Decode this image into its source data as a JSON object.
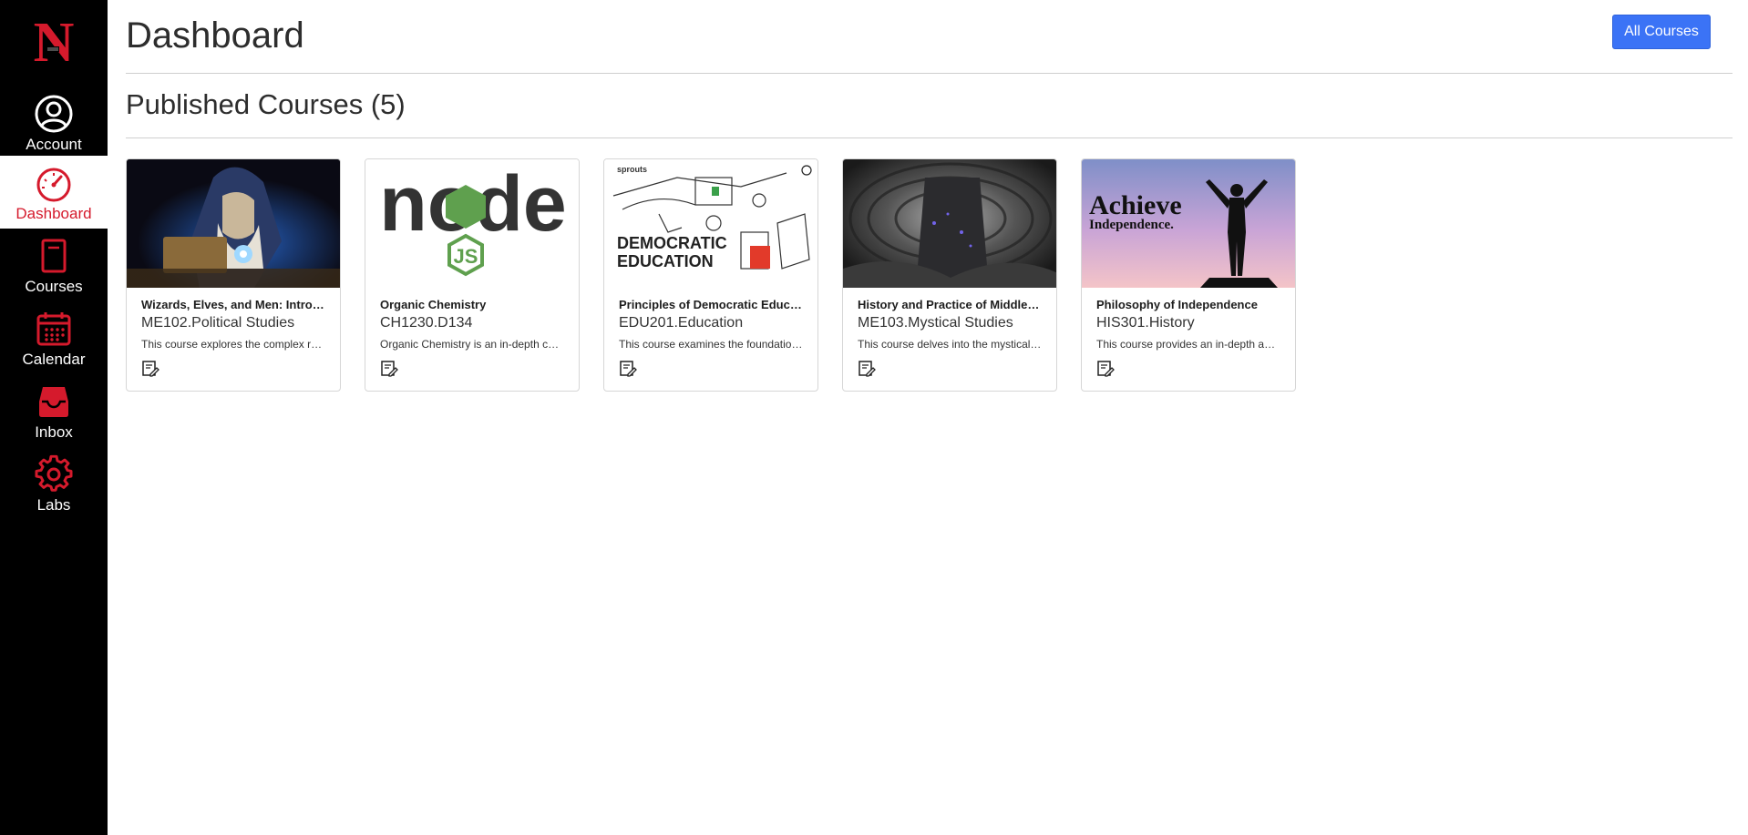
{
  "brand": {
    "logo_letter": "N",
    "accent": "#d51a2c"
  },
  "sidebar": {
    "items": [
      {
        "label": "Account",
        "icon": "account-icon"
      },
      {
        "label": "Dashboard",
        "icon": "dashboard-icon",
        "active": true
      },
      {
        "label": "Courses",
        "icon": "courses-icon"
      },
      {
        "label": "Calendar",
        "icon": "calendar-icon"
      },
      {
        "label": "Inbox",
        "icon": "inbox-icon"
      },
      {
        "label": "Labs",
        "icon": "gear-icon"
      }
    ]
  },
  "header": {
    "title": "Dashboard",
    "all_courses_label": "All Courses"
  },
  "published": {
    "heading": "Published Courses",
    "count_text": "(5)"
  },
  "courses": [
    {
      "title": "Wizards, Elves, and Men: Introduction",
      "code": "ME102.Political Studies",
      "description": "This course explores the complex relationships between wizards, elves, and men.",
      "image_icon": "wizard-image"
    },
    {
      "title": "Organic Chemistry",
      "code": "CH1230.D134",
      "description": "Organic Chemistry is an in-depth course on carbon compounds.",
      "image_icon": "nodejs-logo-image",
      "image_text_1": "node",
      "image_text_2": "JS"
    },
    {
      "title": "Principles of Democratic Education",
      "code": "EDU201.Education",
      "description": "This course examines the foundations of democratic education.",
      "image_icon": "democratic-education-image",
      "image_text_1": "DEMOCRATIC",
      "image_text_2": "EDUCATION",
      "image_text_3": "sprouts"
    },
    {
      "title": "History and Practice of Middle-earth Magic",
      "code": "ME103.Mystical Studies",
      "description": "This course delves into the mystical arts of Middle-earth.",
      "image_icon": "mystical-tower-image"
    },
    {
      "title": "Philosophy of Independence",
      "code": "HIS301.History",
      "description": "This course provides an in-depth analysis of independence.",
      "image_icon": "achieve-independence-image",
      "image_text_1": "Achieve",
      "image_text_2": "Independence."
    }
  ]
}
